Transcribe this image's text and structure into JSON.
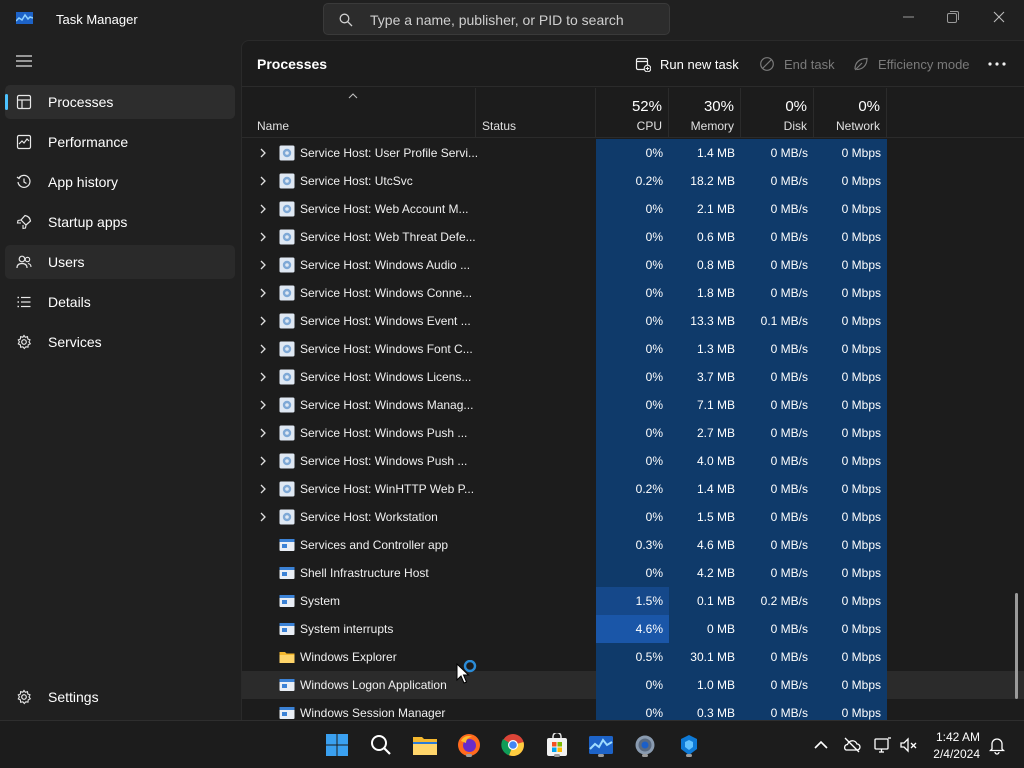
{
  "window": {
    "title": "Task Manager",
    "search_placeholder": "Type a name, publisher, or PID to search"
  },
  "nav": {
    "items": [
      {
        "label": "Processes",
        "icon": "processes-icon"
      },
      {
        "label": "Performance",
        "icon": "performance-icon"
      },
      {
        "label": "App history",
        "icon": "app-history-icon"
      },
      {
        "label": "Startup apps",
        "icon": "startup-apps-icon"
      },
      {
        "label": "Users",
        "icon": "users-icon"
      },
      {
        "label": "Details",
        "icon": "details-icon"
      },
      {
        "label": "Services",
        "icon": "services-icon"
      }
    ],
    "settings_label": "Settings",
    "selected": "Processes"
  },
  "toolbar": {
    "page_title": "Processes",
    "run_new_task": "Run new task",
    "end_task": "End task",
    "efficiency_mode": "Efficiency mode"
  },
  "columns": {
    "name": "Name",
    "status": "Status",
    "cpu": {
      "pct": "52%",
      "label": "CPU"
    },
    "memory": {
      "pct": "30%",
      "label": "Memory"
    },
    "disk": {
      "pct": "0%",
      "label": "Disk"
    },
    "network": {
      "pct": "0%",
      "label": "Network"
    }
  },
  "processes": [
    {
      "name": "Service Host: User Profile Servi...",
      "cpu": "0%",
      "memory": "1.4 MB",
      "disk": "0 MB/s",
      "network": "0 Mbps",
      "expandable": true,
      "icon": "gear"
    },
    {
      "name": "Service Host: UtcSvc",
      "cpu": "0.2%",
      "memory": "18.2 MB",
      "disk": "0 MB/s",
      "network": "0 Mbps",
      "expandable": true,
      "icon": "gear"
    },
    {
      "name": "Service Host: Web Account M...",
      "cpu": "0%",
      "memory": "2.1 MB",
      "disk": "0 MB/s",
      "network": "0 Mbps",
      "expandable": true,
      "icon": "gear"
    },
    {
      "name": "Service Host: Web Threat Defe...",
      "cpu": "0%",
      "memory": "0.6 MB",
      "disk": "0 MB/s",
      "network": "0 Mbps",
      "expandable": true,
      "icon": "gear"
    },
    {
      "name": "Service Host: Windows Audio ...",
      "cpu": "0%",
      "memory": "0.8 MB",
      "disk": "0 MB/s",
      "network": "0 Mbps",
      "expandable": true,
      "icon": "gear"
    },
    {
      "name": "Service Host: Windows Conne...",
      "cpu": "0%",
      "memory": "1.8 MB",
      "disk": "0 MB/s",
      "network": "0 Mbps",
      "expandable": true,
      "icon": "gear"
    },
    {
      "name": "Service Host: Windows Event ...",
      "cpu": "0%",
      "memory": "13.3 MB",
      "disk": "0.1 MB/s",
      "network": "0 Mbps",
      "expandable": true,
      "icon": "gear"
    },
    {
      "name": "Service Host: Windows Font C...",
      "cpu": "0%",
      "memory": "1.3 MB",
      "disk": "0 MB/s",
      "network": "0 Mbps",
      "expandable": true,
      "icon": "gear"
    },
    {
      "name": "Service Host: Windows Licens...",
      "cpu": "0%",
      "memory": "3.7 MB",
      "disk": "0 MB/s",
      "network": "0 Mbps",
      "expandable": true,
      "icon": "gear"
    },
    {
      "name": "Service Host: Windows Manag...",
      "cpu": "0%",
      "memory": "7.1 MB",
      "disk": "0 MB/s",
      "network": "0 Mbps",
      "expandable": true,
      "icon": "gear"
    },
    {
      "name": "Service Host: Windows Push ...",
      "cpu": "0%",
      "memory": "2.7 MB",
      "disk": "0 MB/s",
      "network": "0 Mbps",
      "expandable": true,
      "icon": "gear"
    },
    {
      "name": "Service Host: Windows Push ...",
      "cpu": "0%",
      "memory": "4.0 MB",
      "disk": "0 MB/s",
      "network": "0 Mbps",
      "expandable": true,
      "icon": "gear"
    },
    {
      "name": "Service Host: WinHTTP Web P...",
      "cpu": "0.2%",
      "memory": "1.4 MB",
      "disk": "0 MB/s",
      "network": "0 Mbps",
      "expandable": true,
      "icon": "gear"
    },
    {
      "name": "Service Host: Workstation",
      "cpu": "0%",
      "memory": "1.5 MB",
      "disk": "0 MB/s",
      "network": "0 Mbps",
      "expandable": true,
      "icon": "gear"
    },
    {
      "name": "Services and Controller app",
      "cpu": "0.3%",
      "memory": "4.6 MB",
      "disk": "0 MB/s",
      "network": "0 Mbps",
      "expandable": false,
      "icon": "window"
    },
    {
      "name": "Shell Infrastructure Host",
      "cpu": "0%",
      "memory": "4.2 MB",
      "disk": "0 MB/s",
      "network": "0 Mbps",
      "expandable": false,
      "icon": "window"
    },
    {
      "name": "System",
      "cpu": "1.5%",
      "memory": "0.1 MB",
      "disk": "0.2 MB/s",
      "network": "0 Mbps",
      "expandable": false,
      "icon": "window"
    },
    {
      "name": "System interrupts",
      "cpu": "4.6%",
      "memory": "0 MB",
      "disk": "0 MB/s",
      "network": "0 Mbps",
      "expandable": false,
      "icon": "window"
    },
    {
      "name": "Windows Explorer",
      "cpu": "0.5%",
      "memory": "30.1 MB",
      "disk": "0 MB/s",
      "network": "0 Mbps",
      "expandable": false,
      "icon": "folder"
    },
    {
      "name": "Windows Logon Application",
      "cpu": "0%",
      "memory": "1.0 MB",
      "disk": "0 MB/s",
      "network": "0 Mbps",
      "expandable": false,
      "icon": "window"
    },
    {
      "name": "Windows Session Manager",
      "cpu": "0%",
      "memory": "0.3 MB",
      "disk": "0 MB/s",
      "network": "0 Mbps",
      "expandable": false,
      "icon": "window"
    }
  ],
  "taskbar": {
    "apps": [
      "start-icon",
      "search-icon",
      "file-explorer-icon",
      "firefox-icon",
      "chrome-icon",
      "store-icon",
      "task-manager-icon",
      "settings-icon",
      "app-icon"
    ],
    "time": "1:42 AM",
    "date": "2/4/2024"
  },
  "colors": {
    "accent": "#4cc2ff",
    "heat_low": "#0f3a6a",
    "heat_mid": "#15488a",
    "heat_high": "#1a56a8",
    "background": "#1c1c1c"
  }
}
